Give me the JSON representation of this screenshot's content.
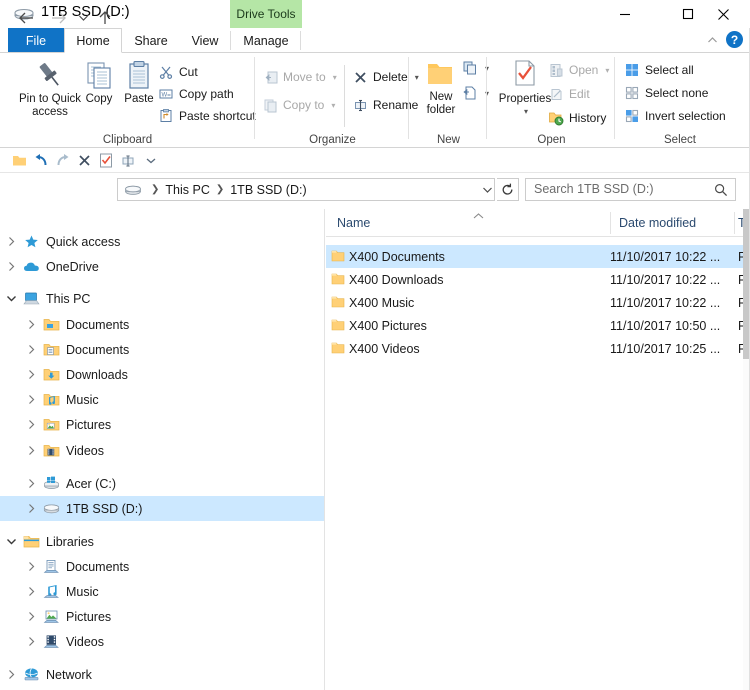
{
  "window": {
    "title": "1TB SSD (D:)",
    "drive_tools_tab": "Drive Tools",
    "minimize_label": "Minimize",
    "maximize_label": "Maximize",
    "close_label": "Close",
    "help_label": "?",
    "collapse_ribbon_label": "Collapse the Ribbon"
  },
  "tabs": [
    {
      "label": "File",
      "active": false,
      "id": "file"
    },
    {
      "label": "Home",
      "active": true,
      "id": "home"
    },
    {
      "label": "Share",
      "active": false,
      "id": "share"
    },
    {
      "label": "View",
      "active": false,
      "id": "view"
    },
    {
      "label": "Manage",
      "active": false,
      "id": "manage"
    }
  ],
  "ribbon": {
    "clipboard": {
      "group_label": "Clipboard",
      "pin_label": "Pin to Quick\naccess",
      "pin_line1": "Pin to Quick",
      "pin_line2": "access",
      "copy_label": "Copy",
      "paste_label": "Paste",
      "cut_label": "Cut",
      "copy_path_label": "Copy path",
      "paste_shortcut_label": "Paste shortcut"
    },
    "organize": {
      "group_label": "Organize",
      "move_to_label": "Move to",
      "copy_to_label": "Copy to",
      "delete_label": "Delete",
      "rename_label": "Rename"
    },
    "new": {
      "group_label": "New",
      "new_folder_line1": "New",
      "new_folder_line2": "folder"
    },
    "open": {
      "group_label": "Open",
      "properties_label": "Properties",
      "open_label": "Open",
      "edit_label": "Edit",
      "history_label": "History"
    },
    "select": {
      "group_label": "Select",
      "select_all_label": "Select all",
      "select_none_label": "Select none",
      "invert_selection_label": "Invert selection"
    }
  },
  "quick_toolbar": {
    "items": [
      {
        "name": "new-folder-icon"
      },
      {
        "name": "undo-icon"
      },
      {
        "name": "redo-icon"
      },
      {
        "name": "delete-icon"
      },
      {
        "name": "properties-icon"
      },
      {
        "name": "rename-icon"
      },
      {
        "name": "customize-dropdown-icon"
      }
    ]
  },
  "address": {
    "back_label": "Back",
    "forward_label": "Forward",
    "recent_label": "Recent locations",
    "up_label": "Up",
    "breadcrumbs": [
      "This PC",
      "1TB SSD (D:)"
    ],
    "refresh_label": "Refresh",
    "dropdown_label": "Previous locations"
  },
  "search": {
    "placeholder": "Search 1TB SSD (D:)",
    "value": ""
  },
  "nav_tree": [
    {
      "label": "Quick access",
      "icon": "star-icon",
      "indent": 0,
      "expander": "collapsed",
      "selected": false
    },
    {
      "label": "OneDrive",
      "icon": "cloud-icon",
      "indent": 0,
      "expander": "collapsed",
      "selected": false
    },
    {
      "label": "This PC",
      "icon": "pc-icon",
      "indent": 0,
      "expander": "expanded",
      "selected": false
    },
    {
      "label": "Documents",
      "icon": "folder-desktop-icon",
      "indent": 1,
      "expander": "collapsed",
      "selected": false
    },
    {
      "label": "Documents",
      "icon": "folder-docs-icon",
      "indent": 1,
      "expander": "collapsed",
      "selected": false
    },
    {
      "label": "Downloads",
      "icon": "folder-downloads-icon",
      "indent": 1,
      "expander": "collapsed",
      "selected": false
    },
    {
      "label": "Music",
      "icon": "folder-music-icon",
      "indent": 1,
      "expander": "collapsed",
      "selected": false
    },
    {
      "label": "Pictures",
      "icon": "folder-pictures-icon",
      "indent": 1,
      "expander": "collapsed",
      "selected": false
    },
    {
      "label": "Videos",
      "icon": "folder-videos-icon",
      "indent": 1,
      "expander": "collapsed",
      "selected": false
    },
    {
      "label": "Acer (C:)",
      "icon": "windows-drive-icon",
      "indent": 1,
      "expander": "collapsed",
      "selected": false
    },
    {
      "label": "1TB SSD (D:)",
      "icon": "drive-icon",
      "indent": 1,
      "expander": "collapsed",
      "selected": true
    },
    {
      "label": "Libraries",
      "icon": "libraries-icon",
      "indent": 0,
      "expander": "expanded",
      "selected": false
    },
    {
      "label": "Documents",
      "icon": "lib-documents-icon",
      "indent": 1,
      "expander": "collapsed",
      "selected": false
    },
    {
      "label": "Music",
      "icon": "lib-music-icon",
      "indent": 1,
      "expander": "collapsed",
      "selected": false
    },
    {
      "label": "Pictures",
      "icon": "lib-pictures-icon",
      "indent": 1,
      "expander": "collapsed",
      "selected": false
    },
    {
      "label": "Videos",
      "icon": "lib-videos-icon",
      "indent": 1,
      "expander": "collapsed",
      "selected": false
    },
    {
      "label": "Network",
      "icon": "network-icon",
      "indent": 0,
      "expander": "collapsed",
      "selected": false
    }
  ],
  "file_list": {
    "columns": [
      {
        "label": "Name",
        "sorted": true
      },
      {
        "label": "Date modified",
        "sorted": false
      },
      {
        "label": "T",
        "sorted": false
      }
    ],
    "rows": [
      {
        "name": "X400 Documents",
        "date": "11/10/2017 10:22 ...",
        "type": "F",
        "selected": true
      },
      {
        "name": "X400 Downloads",
        "date": "11/10/2017 10:22 ...",
        "type": "F",
        "selected": false
      },
      {
        "name": "X400 Music",
        "date": "11/10/2017 10:22 ...",
        "type": "F",
        "selected": false
      },
      {
        "name": "X400 Pictures",
        "date": "11/10/2017 10:50 ...",
        "type": "F",
        "selected": false
      },
      {
        "name": "X400 Videos",
        "date": "11/10/2017 10:25 ...",
        "type": "F",
        "selected": false
      }
    ]
  },
  "colors": {
    "accent": "#1073c6",
    "selection": "#cce8ff",
    "contextual_tab": "#b5e6a6",
    "folder_yellow": "#ffd076",
    "header_text": "#2b4a6f"
  }
}
